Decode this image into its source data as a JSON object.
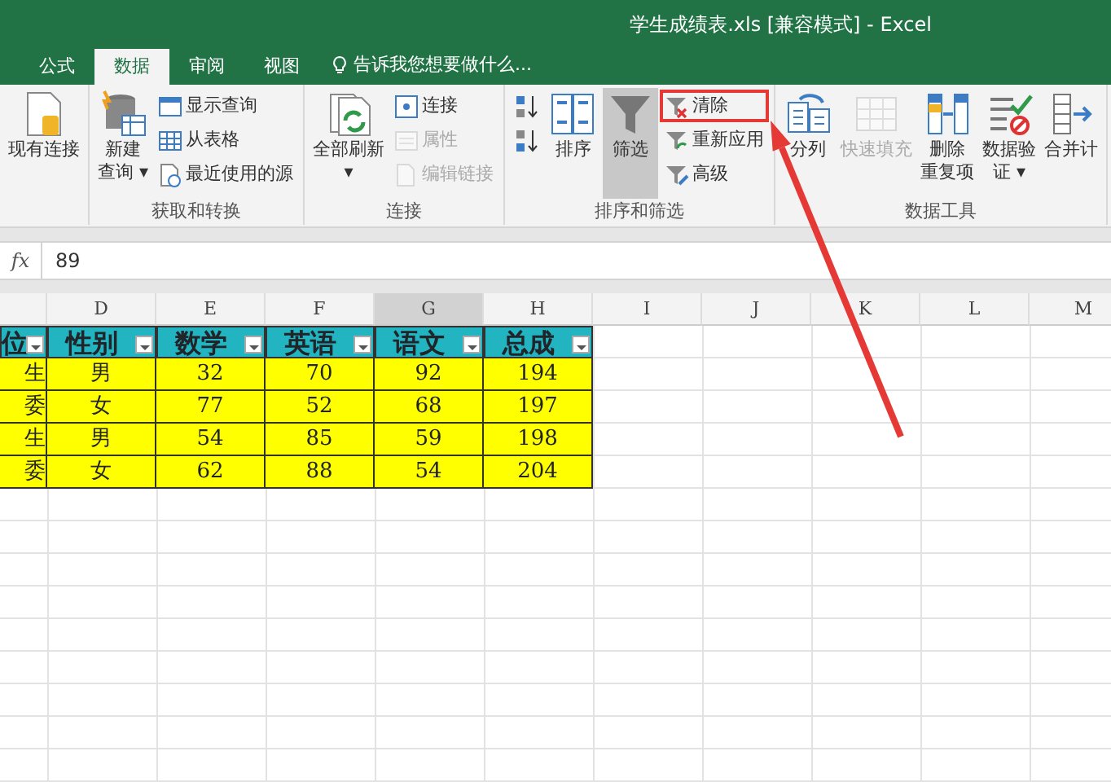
{
  "window": {
    "title": "学生成绩表.xls  [兼容模式] - Excel"
  },
  "tabs": [
    {
      "label": "公式",
      "selected": false
    },
    {
      "label": "数据",
      "selected": true
    },
    {
      "label": "审阅",
      "selected": false
    },
    {
      "label": "视图",
      "selected": false
    }
  ],
  "tell_me": "告诉我您想要做什么...",
  "ribbon": {
    "groups": [
      {
        "columns": [
          {
            "kind": "large",
            "lines": [
              "现有连接"
            ],
            "disabled": false,
            "on": false
          }
        ]
      },
      {
        "label": "获取和转换",
        "columns": [
          {
            "kind": "large",
            "lines": [
              "新建",
              "查询 ▾"
            ],
            "disabled": false,
            "on": false
          },
          {
            "kind": "stack",
            "items": [
              {
                "label": "显示查询",
                "disabled": false,
                "highlighted": false
              },
              {
                "label": "从表格",
                "disabled": false,
                "highlighted": false
              },
              {
                "label": "最近使用的源",
                "disabled": false,
                "highlighted": false
              }
            ]
          }
        ]
      },
      {
        "label": "连接",
        "columns": [
          {
            "kind": "large",
            "lines": [
              "全部刷新",
              "▾"
            ],
            "disabled": false,
            "on": false
          },
          {
            "kind": "stack",
            "items": [
              {
                "label": "连接",
                "disabled": false,
                "highlighted": false
              },
              {
                "label": "属性",
                "disabled": true,
                "highlighted": false
              },
              {
                "label": "编辑链接",
                "disabled": true,
                "highlighted": false
              }
            ]
          }
        ]
      },
      {
        "label": "排序和筛选",
        "columns": [
          {
            "kind": "stack",
            "items": [
              {
                "disabled": false,
                "highlighted": false
              },
              {
                "disabled": false,
                "highlighted": false
              }
            ]
          },
          {
            "kind": "large",
            "lines": [
              "排序"
            ],
            "disabled": false,
            "on": false
          },
          {
            "kind": "large",
            "lines": [
              "筛选"
            ],
            "disabled": false,
            "on": true
          },
          {
            "kind": "stack",
            "items": [
              {
                "label": "清除",
                "disabled": false,
                "highlighted": true
              },
              {
                "label": "重新应用",
                "disabled": false,
                "highlighted": false
              },
              {
                "label": "高级",
                "disabled": false,
                "highlighted": false
              }
            ]
          }
        ]
      },
      {
        "label": "数据工具",
        "columns": [
          {
            "kind": "large",
            "lines": [
              "分列"
            ],
            "disabled": false,
            "on": false
          },
          {
            "kind": "large",
            "lines": [
              "快速填充"
            ],
            "disabled": true,
            "on": false
          },
          {
            "kind": "large",
            "lines": [
              "删除",
              "重复项"
            ],
            "disabled": false,
            "on": false
          },
          {
            "kind": "large",
            "lines": [
              "数据验",
              "证 ▾"
            ],
            "disabled": false,
            "on": false
          },
          {
            "kind": "large",
            "lines": [
              "合并计"
            ],
            "disabled": false,
            "on": false
          }
        ]
      }
    ]
  },
  "formula_bar": {
    "function_label": "fx",
    "value": "89"
  },
  "sheet": {
    "columns": [
      {
        "selected": false
      },
      {
        "letter": "D",
        "selected": false
      },
      {
        "letter": "E",
        "selected": false
      },
      {
        "letter": "F",
        "selected": false
      },
      {
        "letter": "G",
        "selected": true
      },
      {
        "letter": "H",
        "selected": false
      },
      {
        "letter": "I",
        "selected": false
      },
      {
        "letter": "J",
        "selected": false
      },
      {
        "letter": "K",
        "selected": false
      },
      {
        "letter": "L",
        "selected": false
      },
      {
        "letter": "M",
        "selected": false
      }
    ],
    "header": [
      "位",
      "性别",
      "数学",
      "英语",
      "语文",
      "总成"
    ],
    "rows": [
      [
        "生",
        "男",
        "32",
        "70",
        "92",
        "194"
      ],
      [
        "委",
        "女",
        "77",
        "52",
        "68",
        "197"
      ],
      [
        "生",
        "男",
        "54",
        "85",
        "59",
        "198"
      ],
      [
        "委",
        "女",
        "62",
        "88",
        "54",
        "204"
      ]
    ]
  }
}
